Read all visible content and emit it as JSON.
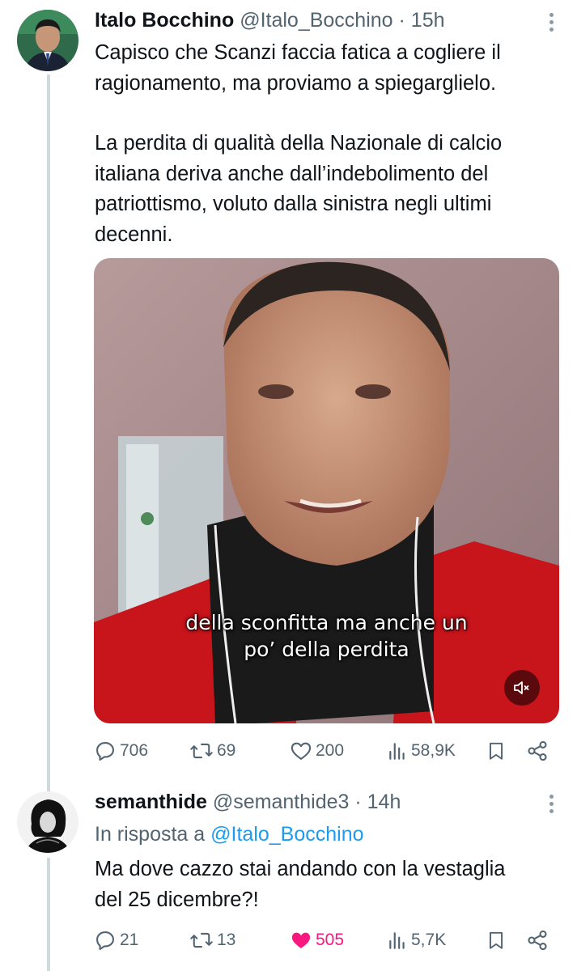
{
  "tweet": {
    "author_name": "Italo Bocchino",
    "author_handle": "@Italo_Bocchino",
    "time": "· 15h",
    "text_p1": "Capisco che Scanzi faccia fatica a cogliere il\nragionamento, ma proviamo a spiegarglielo.",
    "text_p2": "La perdita di qualità della Nazionale di calcio\nitaliana deriva anche dall’indebolimento del\npatriottismo, voluto dalla sinistra negli ultimi\ndecenni.",
    "video_caption": "della sconfitta ma anche un\npo’ della perdita",
    "actions": {
      "replies": "706",
      "retweets": "69",
      "likes": "200",
      "views": "58,9K"
    }
  },
  "reply": {
    "author_name": "semanthide",
    "author_handle": "@semanthide3",
    "time": "· 14h",
    "reply_to_label": "In risposta a",
    "reply_to_handle": "@Italo_Bocchino",
    "text": "Ma dove cazzo stai andando con la vestaglia\ndel 25 dicembre?!",
    "actions": {
      "replies": "21",
      "retweets": "13",
      "likes": "505",
      "views": "5,7K",
      "liked": true
    }
  },
  "colors": {
    "text": "#0f1419",
    "secondary": "#536471",
    "link": "#1d9bf0",
    "like": "#f91880",
    "thread_line": "#cfd9de"
  },
  "icons": [
    "reply-icon",
    "retweet-icon",
    "like-icon",
    "views-icon",
    "bookmark-icon",
    "share-icon",
    "more-icon",
    "muted-icon"
  ]
}
